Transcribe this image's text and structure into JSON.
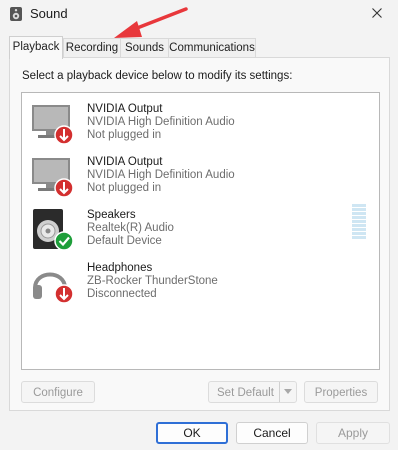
{
  "window": {
    "title": "Sound",
    "title_icon": "speaker-icon",
    "close_icon": "close-icon"
  },
  "tabs": [
    {
      "label": "Playback",
      "active": true
    },
    {
      "label": "Recording",
      "active": false
    },
    {
      "label": "Sounds",
      "active": false
    },
    {
      "label": "Communications",
      "active": false
    }
  ],
  "instruction": "Select a playback device below to modify its settings:",
  "devices": [
    {
      "name": "NVIDIA Output",
      "driver": "NVIDIA High Definition Audio",
      "status": "Not plugged in",
      "icon": "monitor-icon",
      "badge": "unplugged-badge-icon"
    },
    {
      "name": "NVIDIA Output",
      "driver": "NVIDIA High Definition Audio",
      "status": "Not plugged in",
      "icon": "monitor-icon",
      "badge": "unplugged-badge-icon"
    },
    {
      "name": "Speakers",
      "driver": "Realtek(R) Audio",
      "status": "Default Device",
      "icon": "speaker-device-icon",
      "badge": "default-check-badge-icon"
    },
    {
      "name": "Headphones",
      "driver": "ZB-Rocker ThunderStone",
      "status": "Disconnected",
      "icon": "headphones-icon",
      "badge": "unplugged-badge-icon"
    }
  ],
  "buttons": {
    "configure": "Configure",
    "set_default": "Set Default",
    "properties": "Properties",
    "ok": "OK",
    "cancel": "Cancel",
    "apply": "Apply"
  },
  "colors": {
    "accent": "#2f6fd6",
    "annotation_arrow": "#e8373b",
    "unplugged_badge": "#d32f2f",
    "default_badge": "#1e9e3a"
  }
}
